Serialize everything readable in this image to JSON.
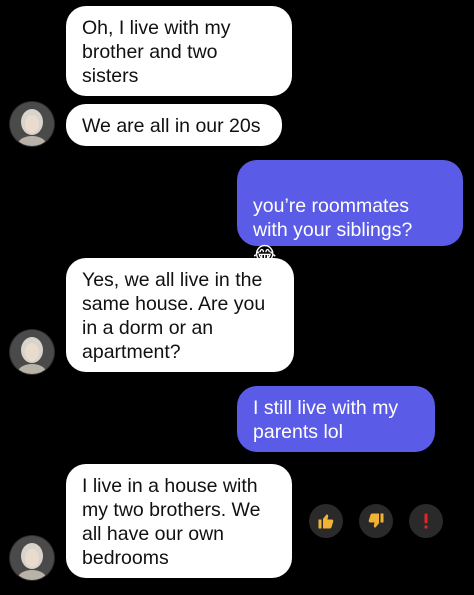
{
  "messages": [
    {
      "sender": "bot",
      "text": "Oh, I live with my\nbrother and two\nsisters"
    },
    {
      "sender": "bot",
      "text": "We are all in our 20s"
    },
    {
      "sender": "user",
      "text": "you’re roommates\nwith your siblings?"
    },
    {
      "sender": "bot",
      "text": "Yes, we all live in the\nsame house. Are you\nin a dorm or an\napartment?"
    },
    {
      "sender": "user",
      "text": "I still live with my\nparents lol"
    },
    {
      "sender": "bot",
      "text": "I live in a house with\nmy two brothers. We\nall have our own\nbedrooms"
    }
  ],
  "emoji": {
    "laugh": "😂"
  },
  "reactions": [
    {
      "icon": "thumbs-up-icon",
      "color": "#f2b233"
    },
    {
      "icon": "thumbs-down-icon",
      "color": "#f2b233"
    },
    {
      "icon": "exclamation-icon",
      "color": "#e0262b"
    }
  ],
  "colors": {
    "background": "#000000",
    "incoming_bubble": "#ffffff",
    "outgoing_bubble": "#5a5be6",
    "reaction_bg": "#2a2a2a"
  }
}
